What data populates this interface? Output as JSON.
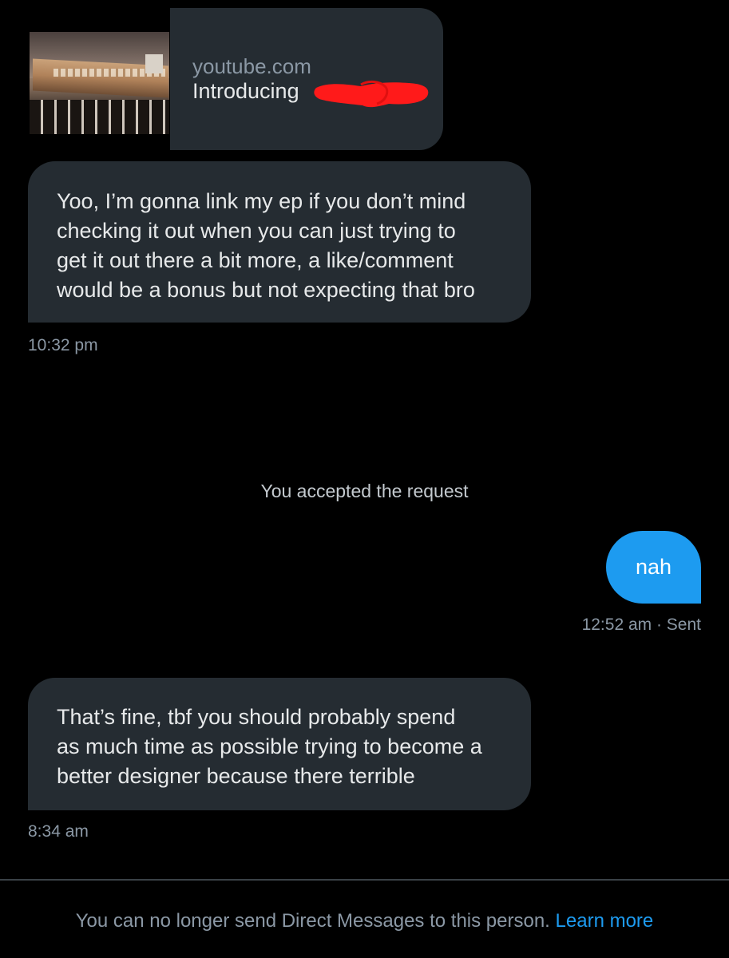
{
  "link_preview": {
    "domain": "youtube.com",
    "title": "Introducing"
  },
  "messages": {
    "first": {
      "lines": [
        "Yoo, I’m gonna link my ep if you don’t mind",
        "checking it out when you can just trying to",
        "get it out there a bit more, a like/comment",
        "would be a bonus but not expecting that bro"
      ],
      "time": "10:32 pm"
    },
    "system": "You accepted the request",
    "sent": {
      "text": "nah",
      "status": "12:52 am · Sent"
    },
    "second": {
      "lines": [
        "That’s fine, tbf you should probably spend",
        "as much time as possible trying to become a",
        "better designer because there terrible"
      ],
      "time": "8:34 am"
    }
  },
  "footer": {
    "notice": "You can no longer send Direct Messages to this person.",
    "link": "Learn more"
  },
  "colors": {
    "background": "#000000",
    "bubble_received": "#252c32",
    "bubble_sent": "#1d9bf0",
    "link": "#1d9bf0",
    "secondary_text": "#8b98a5",
    "redaction": "#ff1a1a"
  }
}
